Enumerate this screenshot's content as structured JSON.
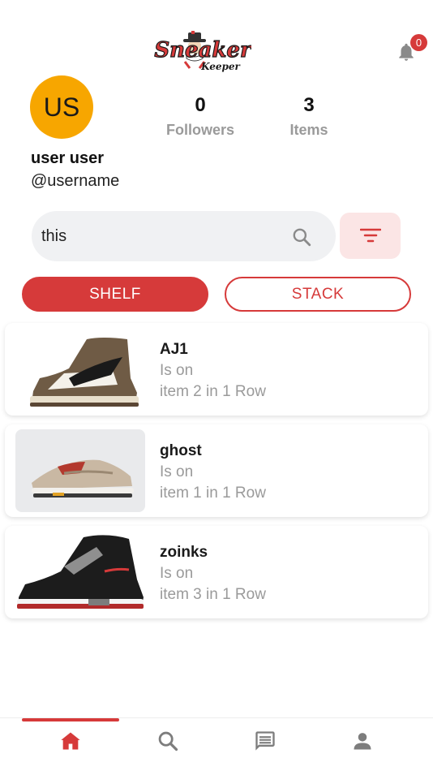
{
  "header": {
    "logo_text_top": "Sneaker",
    "logo_text_bottom": "Keeper",
    "notification_count": "0",
    "bell_icon": "bell-icon"
  },
  "colors": {
    "accent": "#d63a3a",
    "avatar_bg": "#f7a600",
    "muted_text": "#9a9a9a",
    "search_bg": "#f0f1f3",
    "filter_bg": "#fbe5e5"
  },
  "profile": {
    "avatar_initials": "US",
    "followers_count": "0",
    "followers_label": "Followers",
    "items_count": "3",
    "items_label": "Items",
    "name": "user user",
    "handle": "@username"
  },
  "search": {
    "value": "this",
    "search_icon": "search-icon",
    "filter_icon": "filter-icon"
  },
  "tabs": [
    {
      "label": "SHELF",
      "active": true
    },
    {
      "label": "STACK",
      "active": false
    }
  ],
  "items": [
    {
      "name": "AJ1",
      "line1": "Is on",
      "line2": "item 2 in 1 Row",
      "image": "sneaker-image"
    },
    {
      "name": "ghost",
      "line1": "Is on",
      "line2": "item 1 in 1 Row",
      "image": "sneaker-image"
    },
    {
      "name": "zoinks",
      "line1": "Is on",
      "line2": "item 3 in 1 Row",
      "image": "sneaker-image"
    }
  ],
  "bottom_nav": [
    {
      "icon": "home-icon",
      "active": true
    },
    {
      "icon": "search-icon",
      "active": false
    },
    {
      "icon": "chat-icon",
      "active": false
    },
    {
      "icon": "profile-icon",
      "active": false
    }
  ]
}
